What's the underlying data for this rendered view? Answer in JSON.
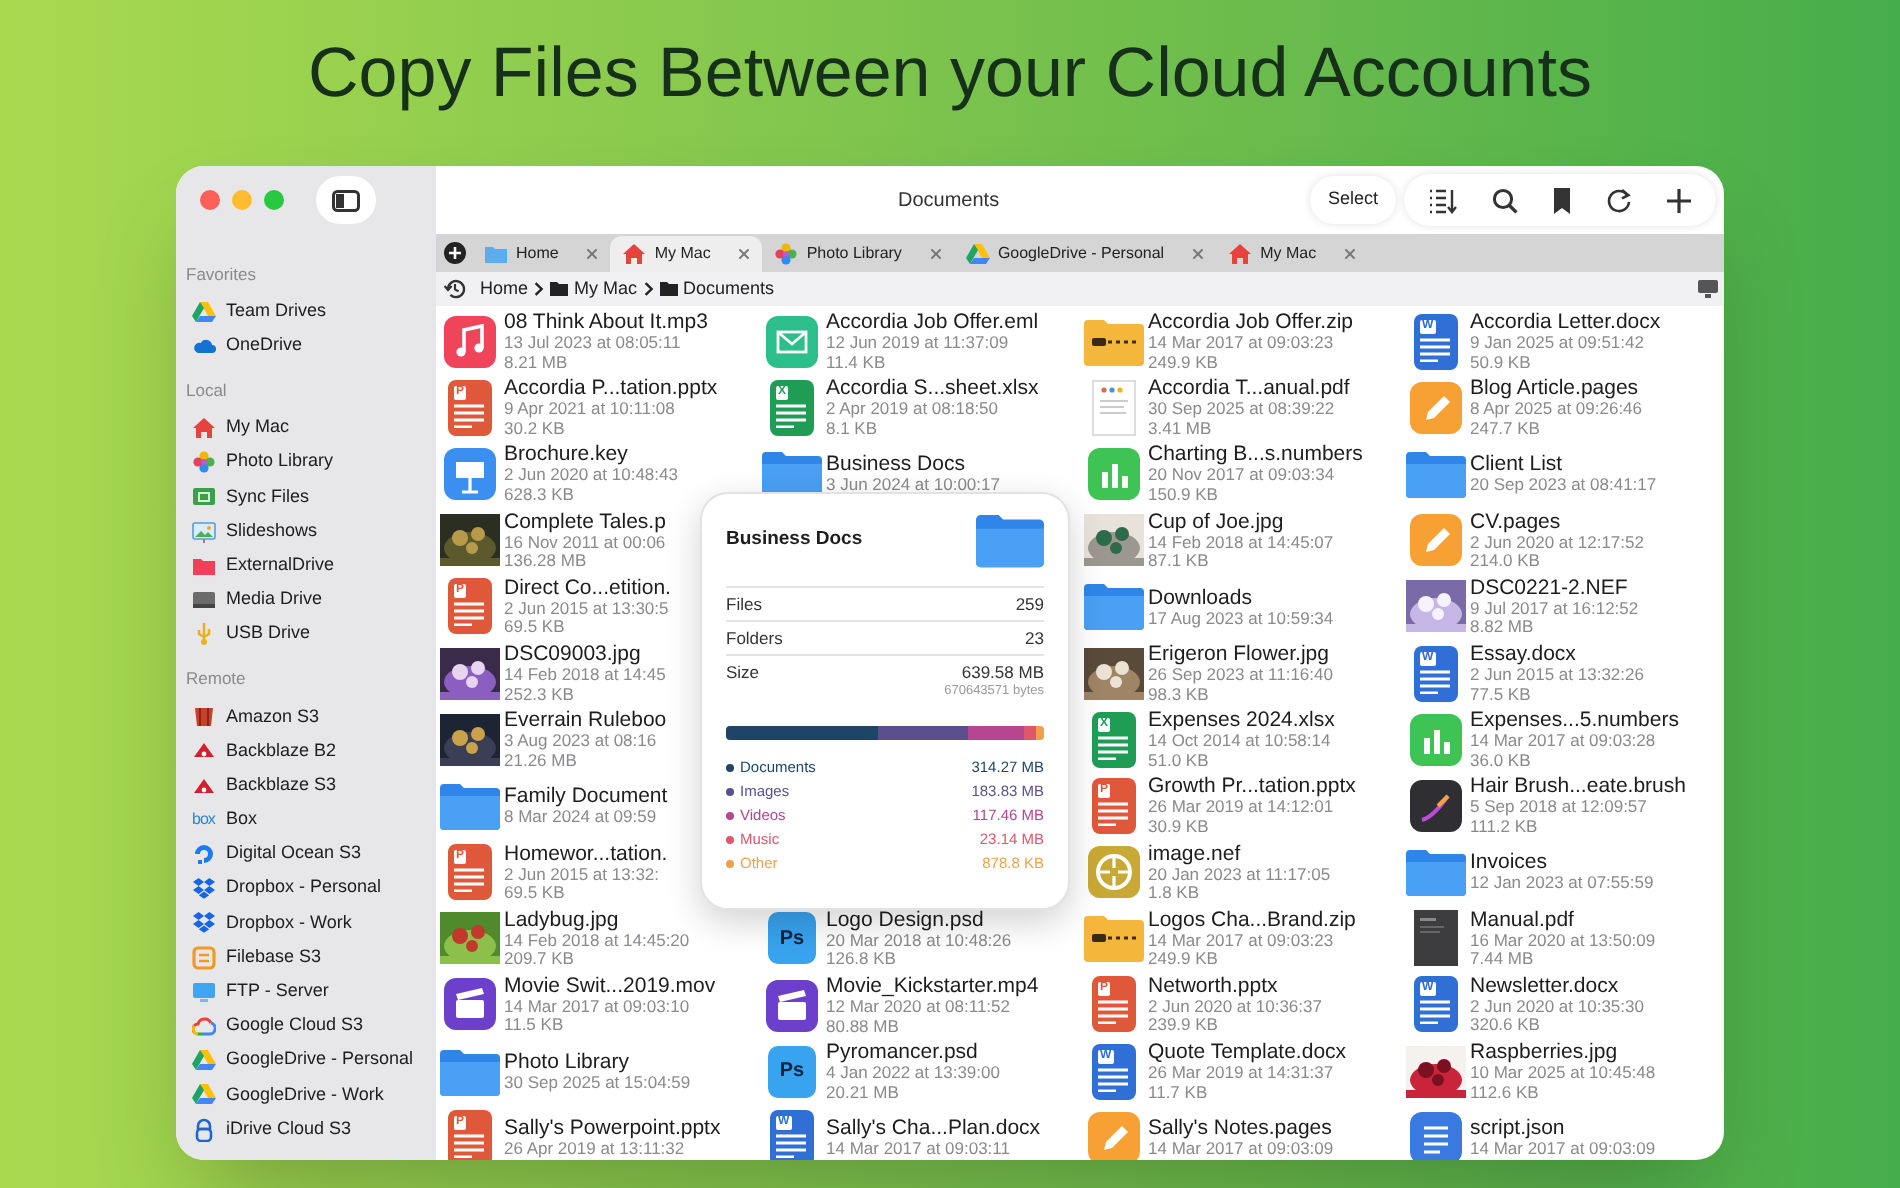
{
  "headline": "Copy Files Between your Cloud Accounts",
  "window": {
    "title": "Documents",
    "select_button": "Select"
  },
  "sidebar": {
    "sections": [
      {
        "header": "Favorites",
        "items": [
          {
            "label": "Team Drives",
            "kind": "gdrive"
          },
          {
            "label": "OneDrive",
            "kind": "onedrive"
          }
        ]
      },
      {
        "header": "Local",
        "items": [
          {
            "label": "My Mac",
            "kind": "house"
          },
          {
            "label": "Photo Library",
            "kind": "photos"
          },
          {
            "label": "Sync Files",
            "kind": "sync"
          },
          {
            "label": "Slideshows",
            "kind": "slides"
          },
          {
            "label": "ExternalDrive",
            "kind": "external"
          },
          {
            "label": "Media Drive",
            "kind": "disk"
          },
          {
            "label": "USB Drive",
            "kind": "usb"
          }
        ]
      },
      {
        "header": "Remote",
        "items": [
          {
            "label": "Amazon S3",
            "kind": "amazon"
          },
          {
            "label": "Backblaze B2",
            "kind": "backblaze"
          },
          {
            "label": "Backblaze S3",
            "kind": "backblaze"
          },
          {
            "label": "Box",
            "kind": "box",
            "icon_text": "box"
          },
          {
            "label": "Digital Ocean S3",
            "kind": "ring"
          },
          {
            "label": "Dropbox - Personal",
            "kind": "dropbox"
          },
          {
            "label": "Dropbox - Work",
            "kind": "dropbox"
          },
          {
            "label": "Filebase S3",
            "kind": "filebase"
          },
          {
            "label": "FTP - Server",
            "kind": "ftp"
          },
          {
            "label": "Google Cloud S3",
            "kind": "gcloud"
          },
          {
            "label": "GoogleDrive - Personal",
            "kind": "gdrive"
          },
          {
            "label": "GoogleDrive - Work",
            "kind": "gdrive"
          },
          {
            "label": "iDrive Cloud S3",
            "kind": "idrive"
          }
        ]
      }
    ]
  },
  "tabs": [
    {
      "label": "Home",
      "kind": "folder",
      "selected": false
    },
    {
      "label": "My Mac",
      "kind": "house",
      "selected": true
    },
    {
      "label": "Photo Library",
      "kind": "photos",
      "selected": false
    },
    {
      "label": "GoogleDrive - Personal",
      "kind": "gdrive",
      "selected": false
    },
    {
      "label": "My Mac",
      "kind": "house",
      "selected": false
    }
  ],
  "breadcrumb": [
    {
      "label": "Home",
      "kind": "plain"
    },
    {
      "label": "My Mac",
      "kind": "folder"
    },
    {
      "label": "Documents",
      "kind": "folder"
    }
  ],
  "columns": [
    {
      "files": [
        {
          "kind": "music",
          "name": "08 Think About It.mp3",
          "date": "13 Jul 2023 at 08:05:11",
          "size": "8.21 MB"
        },
        {
          "kind": "powerpoint",
          "icon_text": "P",
          "name": "Accordia P...tation.pptx",
          "date": "9 Apr 2021 at 10:11:08",
          "size": "30.2 KB"
        },
        {
          "kind": "keynote",
          "name": "Brochure.key",
          "date": "2 Jun 2020 at 10:48:43",
          "size": "628.3 KB"
        },
        {
          "name": "Complete Tales.p",
          "date": "16 Nov 2011 at 00:06",
          "size": "136.28 MB"
        },
        {
          "kind": "powerpoint",
          "icon_text": "P",
          "name": "Direct Co...etition.",
          "date": "2 Jun 2015 at 13:30:5",
          "size": "69.5 KB"
        },
        {
          "name": "DSC09003.jpg",
          "date": "14 Feb 2018 at 14:45",
          "size": "252.3 KB"
        },
        {
          "name": "Everrain Ruleboo",
          "date": "3 Aug 2023 at 08:16",
          "size": "21.26 MB"
        },
        {
          "kind": "folder",
          "name": "Family Document",
          "date": "8 Mar 2024 at 09:59"
        },
        {
          "kind": "powerpoint",
          "icon_text": "P",
          "name": "Homewor...tation.",
          "date": "2 Jun 2015 at 13:32:",
          "size": "69.5 KB"
        },
        {
          "name": "Ladybug.jpg",
          "date": "14 Feb 2018 at 14:45:20",
          "size": "209.7 KB"
        },
        {
          "kind": "movie",
          "name": "Movie Swit...2019.mov",
          "date": "14 Mar 2017 at 09:03:10",
          "size": "11.5 KB"
        },
        {
          "kind": "folder",
          "name": "Photo Library",
          "date": "30 Sep 2025 at 15:04:59"
        },
        {
          "kind": "powerpoint",
          "icon_text": "P",
          "name": "Sally's Powerpoint.pptx",
          "date": "26 Apr 2019 at 13:11:32"
        }
      ]
    },
    {
      "files": [
        {
          "kind": "email",
          "name": "Accordia Job Offer.eml",
          "date": "12 Jun 2019 at 11:37:09",
          "size": "11.4 KB"
        },
        {
          "kind": "excel",
          "icon_text": "X",
          "name": "Accordia S...sheet.xlsx",
          "date": "2 Apr 2019 at 08:18:50",
          "size": "8.1 KB"
        },
        {
          "kind": "folder",
          "name": "Business Docs",
          "date": "3 Jun 2024 at 10:00:17"
        }
      ],
      "files_below_popover": [
        {
          "kind": "psd",
          "icon_text": "Ps",
          "name": "Logo Design.psd",
          "date": "20 Mar 2018 at 10:48:26",
          "size": "126.8 KB"
        },
        {
          "kind": "movie",
          "name": "Movie_Kickstarter.mp4",
          "date": "12 Mar 2020 at 08:11:52",
          "size": "80.88 MB"
        },
        {
          "kind": "psd",
          "icon_text": "Ps",
          "name": "Pyromancer.psd",
          "date": "4 Jan 2022 at 13:39:00",
          "size": "20.21 MB"
        },
        {
          "kind": "word",
          "icon_text": "W",
          "name": "Sally's Cha...Plan.docx",
          "date": "14 Mar 2017 at 09:03:11"
        }
      ]
    },
    {
      "files": [
        {
          "kind": "zip",
          "name": "Accordia Job Offer.zip",
          "date": "14 Mar 2017 at 09:03:23",
          "size": "249.9 KB"
        },
        {
          "kind": "pdf",
          "name": "Accordia T...anual.pdf",
          "date": "30 Sep 2025 at 08:39:22",
          "size": "3.41 MB"
        },
        {
          "kind": "numbers",
          "name": "Charting B...s.numbers",
          "date": "20 Nov 2017 at 09:03:34",
          "size": "150.9 KB"
        },
        {
          "name": "Cup of Joe.jpg",
          "date": "14 Feb 2018 at 14:45:07",
          "size": "87.1 KB"
        },
        {
          "kind": "folder",
          "name": "Downloads",
          "date": "17 Aug 2023 at 10:59:34"
        },
        {
          "name": "Erigeron Flower.jpg",
          "date": "26 Sep 2023 at 11:16:40",
          "size": "98.3 KB"
        },
        {
          "kind": "excel",
          "icon_text": "X",
          "name": "Expenses 2024.xlsx",
          "date": "14 Oct 2014 at 10:58:14",
          "size": "51.0 KB"
        },
        {
          "kind": "powerpoint",
          "icon_text": "P",
          "name": "Growth Pr...tation.pptx",
          "date": "26 Mar 2019 at 14:12:01",
          "size": "30.9 KB"
        },
        {
          "kind": "aperture",
          "name": "image.nef",
          "date": "20 Jan 2023 at 11:17:05",
          "size": "1.8 KB"
        },
        {
          "kind": "zip",
          "name": "Logos Cha...Brand.zip",
          "date": "14 Mar 2017 at 09:03:23",
          "size": "249.9 KB"
        },
        {
          "kind": "powerpoint",
          "icon_text": "P",
          "name": "Networth.pptx",
          "date": "2 Jun 2020 at 10:36:37",
          "size": "239.9 KB"
        },
        {
          "kind": "word",
          "icon_text": "W",
          "name": "Quote Template.docx",
          "date": "26 Mar 2019 at 14:31:37",
          "size": "11.7 KB"
        },
        {
          "kind": "pages",
          "name": "Sally's Notes.pages",
          "date": "14 Mar 2017 at 09:03:09"
        }
      ]
    },
    {
      "files": [
        {
          "kind": "word",
          "icon_text": "W",
          "name": "Accordia Letter.docx",
          "date": "9 Jan 2025 at 09:51:42",
          "size": "50.9 KB"
        },
        {
          "kind": "pages",
          "name": "Blog Article.pages",
          "date": "8 Apr 2025 at 09:26:46",
          "size": "247.7 KB"
        },
        {
          "kind": "folder",
          "name": "Client List",
          "date": "20 Sep 2023 at 08:41:17"
        },
        {
          "kind": "pages",
          "name": "CV.pages",
          "date": "2 Jun 2020 at 12:17:52",
          "size": "214.0 KB"
        },
        {
          "name": "DSC0221-2.NEF",
          "date": "9 Jul 2017 at 16:12:52",
          "size": "8.82 MB"
        },
        {
          "kind": "word",
          "icon_text": "W",
          "name": "Essay.docx",
          "date": "2 Jun 2015 at 13:32:26",
          "size": "77.5 KB"
        },
        {
          "kind": "numbers",
          "name": "Expenses...5.numbers",
          "date": "14 Mar 2017 at 09:03:28",
          "size": "36.0 KB"
        },
        {
          "kind": "brush",
          "name": "Hair Brush...eate.brush",
          "date": "5 Sep 2018 at 12:09:57",
          "size": "111.2 KB"
        },
        {
          "kind": "folder",
          "name": "Invoices",
          "date": "12 Jan 2023 at 07:55:59"
        },
        {
          "kind": "darkdoc",
          "name": "Manual.pdf",
          "date": "16 Mar 2020 at 13:50:09",
          "size": "7.44 MB"
        },
        {
          "kind": "word",
          "icon_text": "W",
          "name": "Newsletter.docx",
          "date": "2 Jun 2020 at 10:35:30",
          "size": "320.6 KB"
        },
        {
          "name": "Raspberries.jpg",
          "date": "10 Mar 2025 at 10:45:48",
          "size": "112.6 KB"
        },
        {
          "kind": "json",
          "name": "script.json",
          "date": "14 Mar 2017 at 09:03:09"
        }
      ]
    }
  ],
  "popover": {
    "title": "Business Docs",
    "stats": [
      {
        "label": "Files",
        "value": "259"
      },
      {
        "label": "Folders",
        "value": "23"
      },
      {
        "label": "Size",
        "value": "639.58 MB",
        "detail": "670643571 bytes"
      }
    ],
    "breakdown": [
      {
        "label": "Documents",
        "value": "314.27 MB",
        "color": "#1f4566"
      },
      {
        "label": "Images",
        "value": "183.83 MB",
        "color": "#5b4f8e"
      },
      {
        "label": "Videos",
        "value": "117.46 MB",
        "color": "#b5468f"
      },
      {
        "label": "Music",
        "value": "23.14 MB",
        "color": "#e0566a"
      },
      {
        "label": "Other",
        "value": "878.8 KB",
        "color": "#f0a04b"
      }
    ]
  }
}
